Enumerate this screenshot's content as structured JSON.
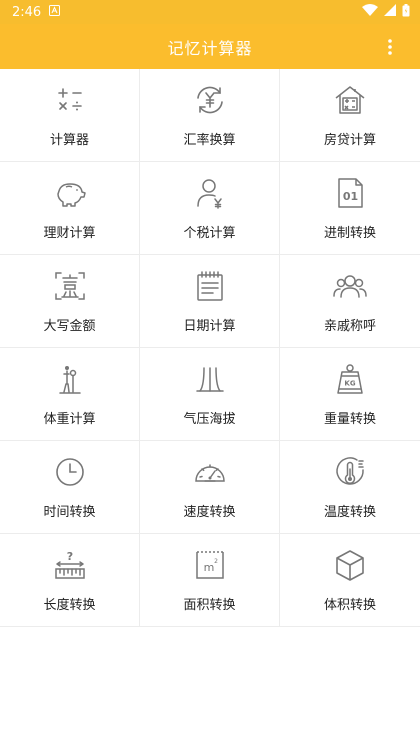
{
  "status": {
    "time": "2:46"
  },
  "app": {
    "title": "记忆计算器"
  },
  "tools": [
    {
      "label": "计算器",
      "icon": "calculator-icon"
    },
    {
      "label": "汇率换算",
      "icon": "currency-exchange-icon"
    },
    {
      "label": "房贷计算",
      "icon": "house-loan-icon"
    },
    {
      "label": "理财计算",
      "icon": "piggy-bank-icon"
    },
    {
      "label": "个税计算",
      "icon": "tax-person-icon"
    },
    {
      "label": "进制转换",
      "icon": "binary-file-icon"
    },
    {
      "label": "大写金额",
      "icon": "capital-amount-icon"
    },
    {
      "label": "日期计算",
      "icon": "calendar-icon"
    },
    {
      "label": "亲戚称呼",
      "icon": "relatives-icon"
    },
    {
      "label": "体重计算",
      "icon": "weight-scale-person-icon"
    },
    {
      "label": "气压海拔",
      "icon": "air-pressure-icon"
    },
    {
      "label": "重量转换",
      "icon": "kg-weight-icon"
    },
    {
      "label": "时间转换",
      "icon": "clock-icon"
    },
    {
      "label": "速度转换",
      "icon": "speedometer-icon"
    },
    {
      "label": "温度转换",
      "icon": "thermometer-icon"
    },
    {
      "label": "长度转换",
      "icon": "ruler-icon"
    },
    {
      "label": "面积转换",
      "icon": "area-icon"
    },
    {
      "label": "体积转换",
      "icon": "cube-icon"
    }
  ]
}
